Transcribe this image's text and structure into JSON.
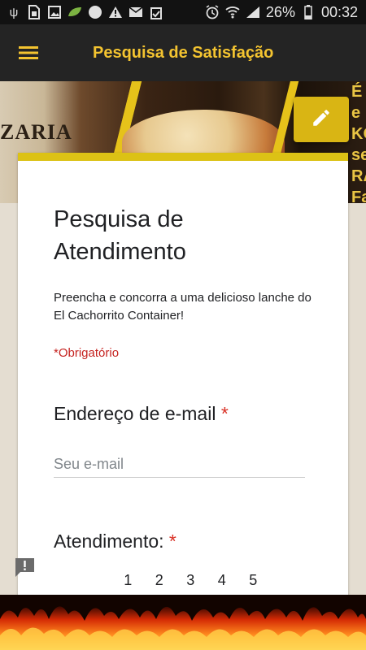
{
  "status_bar": {
    "left_icons": [
      "usb-debug-icon",
      "sim-icon",
      "image-icon",
      "leaf-icon",
      "circle-icon",
      "warning-icon",
      "mail-icon",
      "clipboard-icon"
    ],
    "right_icons": [
      "alarm-icon",
      "wifi-icon",
      "signal-icon",
      "battery-icon"
    ],
    "battery_percent": "26%",
    "time": "00:32"
  },
  "app_bar": {
    "title": "Pesquisa de Satisfação",
    "menu_icon": "hamburger-menu-icon",
    "title_color": "#f4c430",
    "background": "#242424"
  },
  "banner": {
    "left_text": "ZARIA",
    "right_letters": "É e KO se RA Fa"
  },
  "fab": {
    "icon": "pencil-edit-icon",
    "color": "#d9b514"
  },
  "form": {
    "title": "Pesquisa de Atendimento",
    "description": "Preencha e concorra a uma delicioso lanche do El Cachorrito Container!",
    "required_note": "*Obrigatório",
    "questions": [
      {
        "label": "Endereço de e-mail",
        "required_mark": "*",
        "placeholder": "Seu e-mail"
      },
      {
        "label": "Atendimento:",
        "required_mark": "*",
        "scale": [
          "1",
          "2",
          "3",
          "4",
          "5"
        ]
      }
    ],
    "accent_color": "#dcc215"
  },
  "feedback": {
    "icon": "report-feedback-icon"
  }
}
